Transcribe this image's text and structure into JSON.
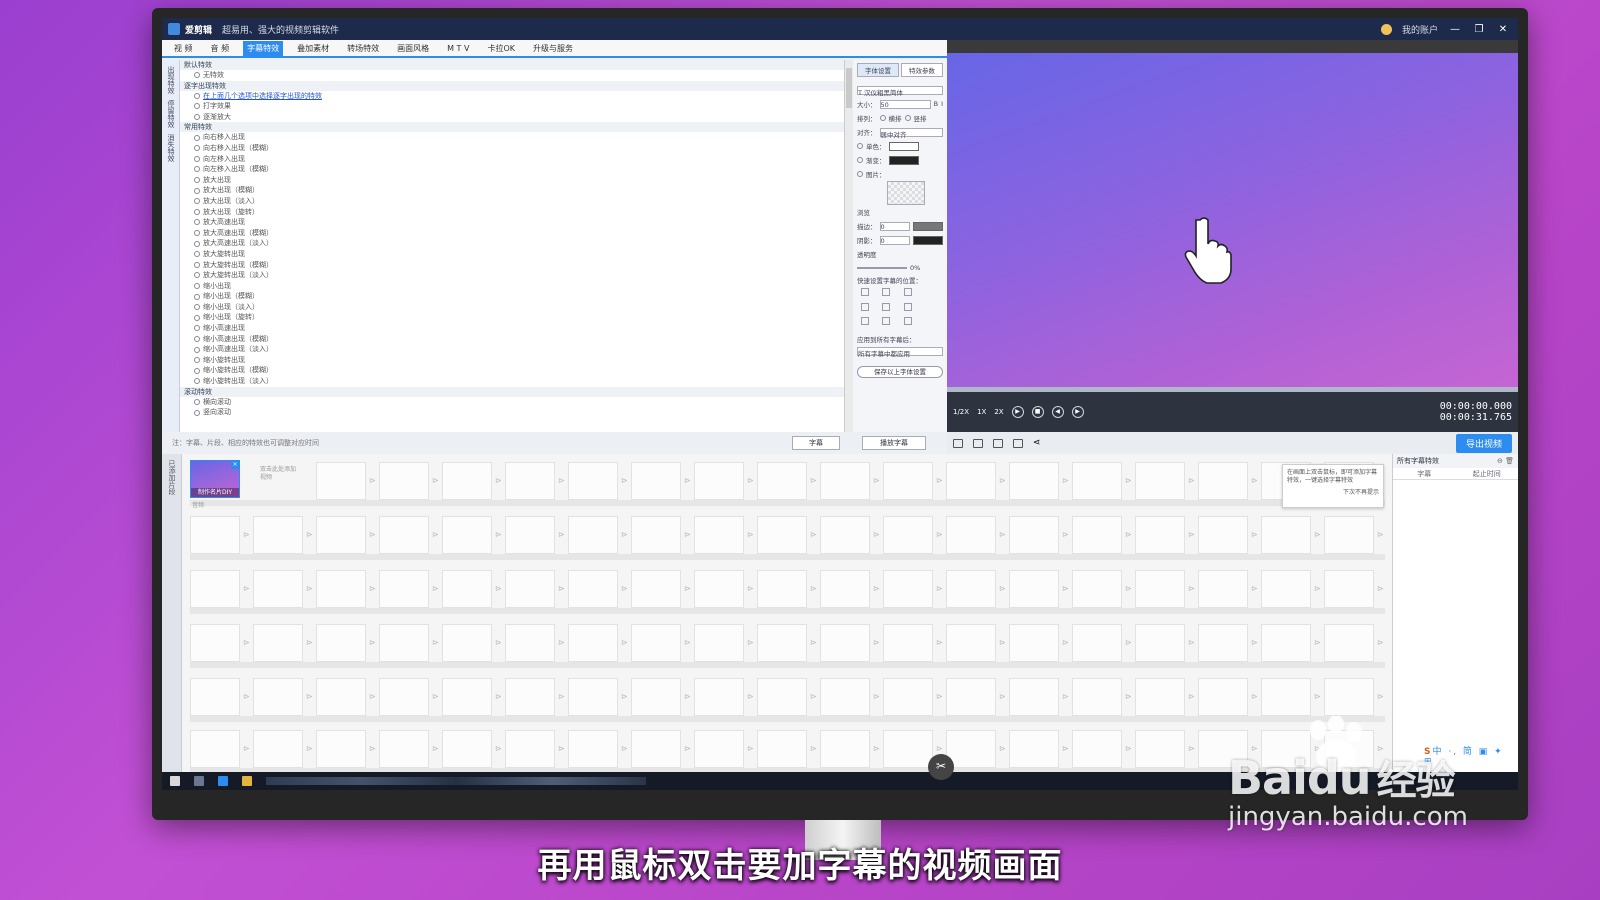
{
  "app": {
    "name": "爱剪辑",
    "slogan": "超易用、强大的视频剪辑软件",
    "user_menu": "我的账户"
  },
  "menu": {
    "tabs": [
      "视 频",
      "音 频",
      "字幕特效",
      "叠加素材",
      "转场特效",
      "画面风格",
      "M T V",
      "卡拉OK",
      "升级与服务"
    ],
    "active": "字幕特效"
  },
  "left_nav": [
    "出现特效",
    "停留特效",
    "消失特效"
  ],
  "effects": {
    "groups": [
      {
        "label": "默认特效",
        "items": [
          "无特效"
        ]
      },
      {
        "label": "逐字出现特效",
        "items": [
          "在上面几个选项中选择逐字出现的特效",
          "打字效果",
          "逐渐放大"
        ]
      },
      {
        "label": "常用特效",
        "items": [
          "向右移入出现",
          "向右移入出现（模糊）",
          "向左移入出现",
          "向左移入出现（模糊）",
          "放大出现",
          "放大出现（模糊）",
          "放大出现（淡入）",
          "放大出现（旋转）",
          "放大高速出现",
          "放大高速出现（模糊）",
          "放大高速出现（淡入）",
          "放大旋转出现",
          "放大旋转出现（模糊）",
          "放大旋转出现（淡入）",
          "缩小出现",
          "缩小出现（模糊）",
          "缩小出现（淡入）",
          "缩小出现（旋转）",
          "缩小高速出现",
          "缩小高速出现（模糊）",
          "缩小高速出现（淡入）",
          "缩小旋转出现",
          "缩小旋转出现（模糊）",
          "缩小旋转出现（淡入）"
        ]
      },
      {
        "label": "滚动特效",
        "items": [
          "横向滚动",
          "竖向滚动"
        ]
      }
    ]
  },
  "settings": {
    "tabs": [
      "字体设置",
      "特效参数"
    ],
    "font_name": "T 汉仪粗黑简体",
    "size_label": "大小：",
    "size_value": "50",
    "bold": "B",
    "italic": "I",
    "layout_label": "排列：",
    "layout_h": "横排",
    "layout_v": "竖排",
    "align_label": "对齐：",
    "align_value": "居中对齐",
    "color_label": "单色：",
    "gradient_label": "渐变：",
    "image_label": "图片：",
    "browse": "浏览",
    "stroke_label": "描边：",
    "stroke_value": "0",
    "shadow_label": "阴影：",
    "shadow_value": "0",
    "opacity_label": "透明度",
    "opacity_value": "0%",
    "pos_label": "快速设置字幕的位置：",
    "apply_label": "应用到所有字幕后：",
    "apply_select": "所有字幕中都应用",
    "save_btn": "保存以上字体设置"
  },
  "hint": {
    "text": "注：字幕、片段、相应的特效也可调整对应时间",
    "btn_a": "字幕",
    "btn_b": "播放字幕"
  },
  "player": {
    "speed_a": "1/2X",
    "speed_b": "1X",
    "speed_c": "2X",
    "time_current": "00:00:00.000",
    "time_total": "00:00:31.765",
    "export": "导出视频"
  },
  "timeline": {
    "side_label": "已添加片段",
    "first_clip": "制作名片DIY",
    "next_hint": "双击此处添加视频",
    "row_label": "音频",
    "tip": "在画面上双击鼠标，即可添加字幕特效，一键选择字幕特效",
    "tip_close": "下次不再提示"
  },
  "subtitle_panel": {
    "title": "所有字幕特效",
    "col_a": "字幕",
    "col_b": "起止时间"
  },
  "ime": "中 ·, 简 ▣ ✦ ⊞",
  "caption": "再用鼠标双击要加字幕的视频画面",
  "watermark": {
    "brand": "Bai",
    "brand2": "du",
    "cn": "经验",
    "url": "jingyan.baidu.com"
  },
  "colors": {
    "accent": "#2d8cf0",
    "titlebar": "#1d2a4b",
    "preview_start": "#6766e6",
    "preview_end": "#c565d3"
  }
}
